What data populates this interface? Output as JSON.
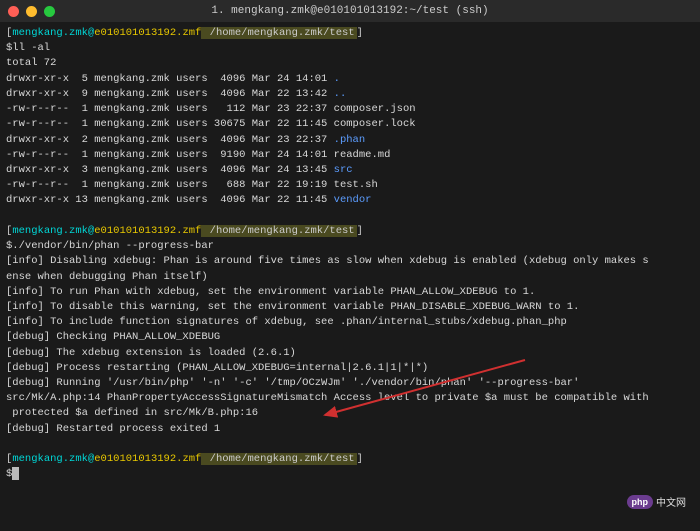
{
  "title_bar": {
    "title": "1. mengkang.zmk@e010101013192:~/test (ssh)"
  },
  "prompt": {
    "user": "mengkang.zmk",
    "at": "@",
    "host": "e010101013192.zmf",
    "path": " /home/mengkang.zmk/test",
    "end": "]"
  },
  "commands": {
    "ll": "$ll -al",
    "phan": "$./vendor/bin/phan --progress-bar",
    "cursor": "$"
  },
  "ls": {
    "total": "total 72",
    "rows": [
      {
        "perm": "drwxr-xr-x",
        "links": " 5",
        "user": "mengkang.zmk",
        "group": "users",
        "size": " 4096",
        "date": "Mar 24 14:01",
        "name": ".",
        "cls": "blue"
      },
      {
        "perm": "drwxr-xr-x",
        "links": " 9",
        "user": "mengkang.zmk",
        "group": "users",
        "size": " 4096",
        "date": "Mar 22 13:42",
        "name": "..",
        "cls": "blue"
      },
      {
        "perm": "-rw-r--r--",
        "links": " 1",
        "user": "mengkang.zmk",
        "group": "users",
        "size": "  112",
        "date": "Mar 23 22:37",
        "name": "composer.json",
        "cls": "white"
      },
      {
        "perm": "-rw-r--r--",
        "links": " 1",
        "user": "mengkang.zmk",
        "group": "users",
        "size": "30675",
        "date": "Mar 22 11:45",
        "name": "composer.lock",
        "cls": "white"
      },
      {
        "perm": "drwxr-xr-x",
        "links": " 2",
        "user": "mengkang.zmk",
        "group": "users",
        "size": " 4096",
        "date": "Mar 23 22:37",
        "name": ".phan",
        "cls": "blue"
      },
      {
        "perm": "-rw-r--r--",
        "links": " 1",
        "user": "mengkang.zmk",
        "group": "users",
        "size": " 9190",
        "date": "Mar 24 14:01",
        "name": "readme.md",
        "cls": "white"
      },
      {
        "perm": "drwxr-xr-x",
        "links": " 3",
        "user": "mengkang.zmk",
        "group": "users",
        "size": " 4096",
        "date": "Mar 24 13:45",
        "name": "src",
        "cls": "blue"
      },
      {
        "perm": "-rw-r--r--",
        "links": " 1",
        "user": "mengkang.zmk",
        "group": "users",
        "size": "  688",
        "date": "Mar 22 19:19",
        "name": "test.sh",
        "cls": "white"
      },
      {
        "perm": "drwxr-xr-x",
        "links": "13",
        "user": "mengkang.zmk",
        "group": "users",
        "size": " 4096",
        "date": "Mar 22 11:45",
        "name": "vendor",
        "cls": "blue"
      }
    ]
  },
  "phan_output": [
    "[info] Disabling xdebug: Phan is around five times as slow when xdebug is enabled (xdebug only makes s",
    "ense when debugging Phan itself)",
    "[info] To run Phan with xdebug, set the environment variable PHAN_ALLOW_XDEBUG to 1.",
    "[info] To disable this warning, set the environment variable PHAN_DISABLE_XDEBUG_WARN to 1.",
    "[info] To include function signatures of xdebug, see .phan/internal_stubs/xdebug.phan_php",
    "[debug] Checking PHAN_ALLOW_XDEBUG",
    "[debug] The xdebug extension is loaded (2.6.1)",
    "[debug] Process restarting (PHAN_ALLOW_XDEBUG=internal|2.6.1|1|*|*)",
    "[debug] Running '/usr/bin/php' '-n' '-c' '/tmp/OCzWJm' './vendor/bin/phan' '--progress-bar'",
    "src/Mk/A.php:14 PhanPropertyAccessSignatureMismatch Access level to private $a must be compatible with",
    " protected $a defined in src/Mk/B.php:16",
    "[debug] Restarted process exited 1"
  ],
  "watermark": {
    "badge": "php",
    "text": "中文网"
  }
}
